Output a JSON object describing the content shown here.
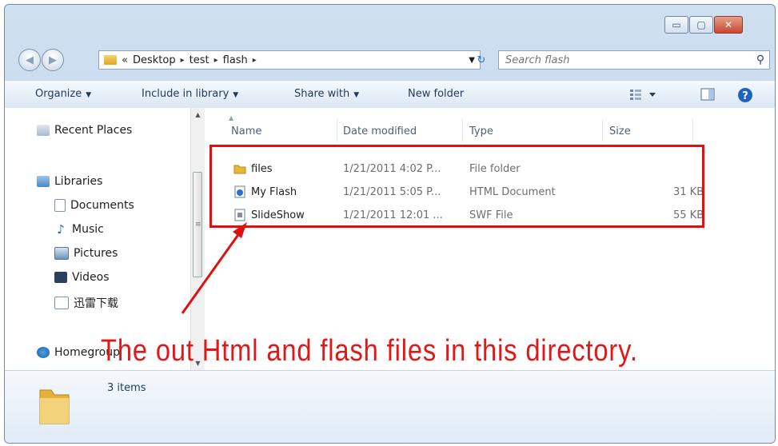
{
  "window": {
    "controls": {
      "minimize": "▭",
      "maximize": "▢",
      "close": "✕"
    }
  },
  "address": {
    "prefix": "«",
    "crumbs": [
      "Desktop",
      "test",
      "flash"
    ],
    "separator": "▸"
  },
  "search": {
    "placeholder": "Search flash"
  },
  "toolbar": {
    "organize": "Organize",
    "include": "Include in library",
    "share": "Share with",
    "new_folder": "New folder"
  },
  "nav": {
    "recent_places": "Recent Places",
    "libraries": "Libraries",
    "documents": "Documents",
    "music": "Music",
    "pictures": "Pictures",
    "videos": "Videos",
    "xunlei": "迅雷下载",
    "homegroup": "Homegroup"
  },
  "columns": {
    "name": "Name",
    "date": "Date modified",
    "type": "Type",
    "size": "Size"
  },
  "files": [
    {
      "name": "files",
      "date": "1/21/2011 4:02 P...",
      "type": "File folder",
      "size": "",
      "icon": "folder-icon"
    },
    {
      "name": "My Flash",
      "date": "1/21/2011 5:05 P...",
      "type": "HTML Document",
      "size": "31 KB",
      "icon": "html-document-icon"
    },
    {
      "name": "SlideShow",
      "date": "1/21/2011 12:01 ...",
      "type": "SWF File",
      "size": "55 KB",
      "icon": "swf-file-icon"
    }
  ],
  "details": {
    "count": "3 items"
  },
  "annotation": {
    "text": "The out Html and flash files in this directory.",
    "color": "#e11818"
  },
  "colors": {
    "accent": "#1e395b",
    "annotation_red": "#e01010",
    "folder_yellow": "#e0a622"
  }
}
